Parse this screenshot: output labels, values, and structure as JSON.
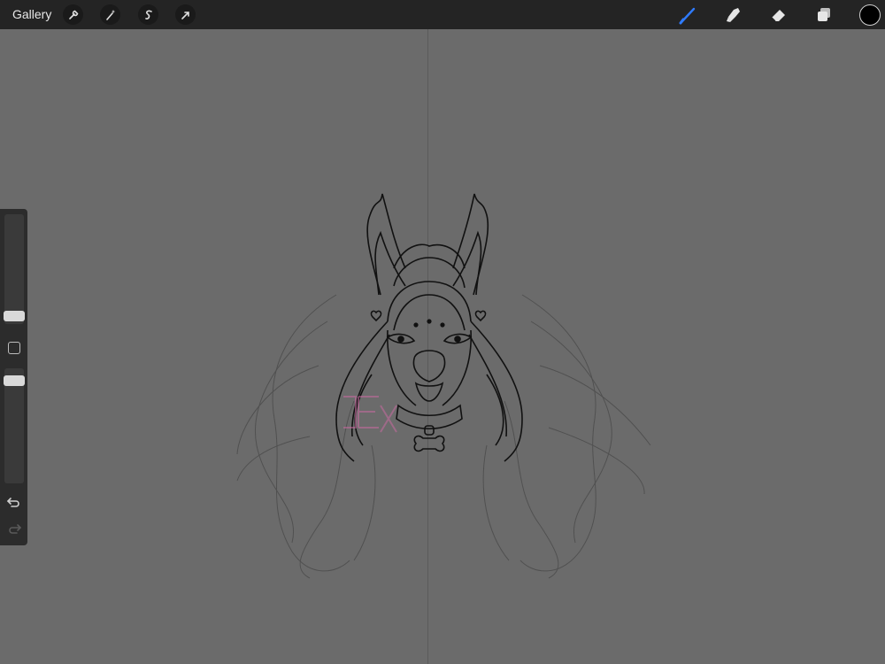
{
  "topbar": {
    "gallery_label": "Gallery",
    "left_tools": [
      "wrench-icon",
      "magic-wand-icon",
      "selection-icon",
      "transform-arrow-icon"
    ],
    "right_tools": [
      "brush-icon",
      "smudge-icon",
      "eraser-icon",
      "layers-icon"
    ],
    "active_tool": "brush-icon",
    "active_color": "#000000",
    "accent_color": "#2f7bff"
  },
  "sidebar": {
    "brush_size": 0.35,
    "opacity": 0.55,
    "modify_icon": "square-modify-icon",
    "undo_icon": "undo-icon",
    "redo_icon": "redo-icon"
  },
  "canvas": {
    "background": "#6b6b6b",
    "symmetry_guide": "vertical"
  }
}
